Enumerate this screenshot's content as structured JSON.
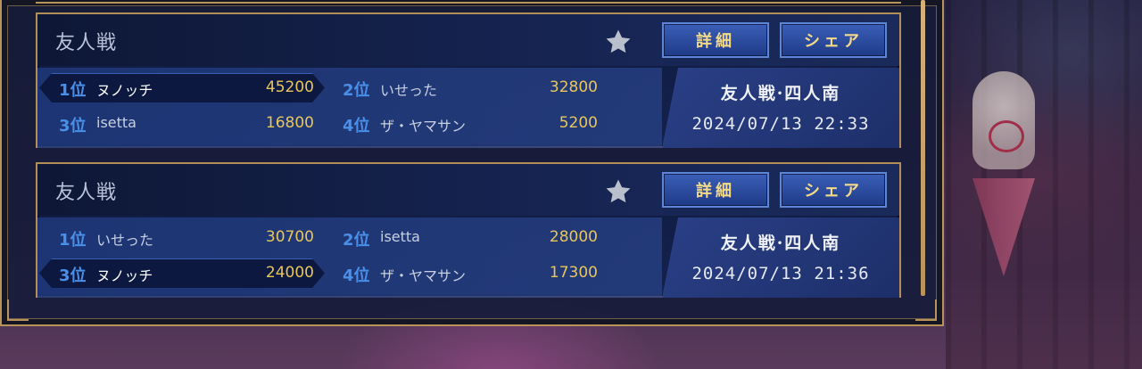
{
  "records": [
    {
      "title": "友人戦",
      "detail_label": "詳細",
      "share_label": "シェア",
      "mode": "友人戦·四人南",
      "datetime": "2024/07/13 22:33",
      "players": [
        {
          "rank": "1位",
          "name": "ヌノッチ",
          "score": "45200",
          "highlight": true
        },
        {
          "rank": "2位",
          "name": "いせった",
          "score": "32800",
          "highlight": false
        },
        {
          "rank": "3位",
          "name": "isetta",
          "score": "16800",
          "highlight": false
        },
        {
          "rank": "4位",
          "name": "ザ・ヤマサン",
          "score": "5200",
          "highlight": false
        }
      ]
    },
    {
      "title": "友人戦",
      "detail_label": "詳細",
      "share_label": "シェア",
      "mode": "友人戦·四人南",
      "datetime": "2024/07/13 21:36",
      "players": [
        {
          "rank": "1位",
          "name": "いせった",
          "score": "30700",
          "highlight": false
        },
        {
          "rank": "2位",
          "name": "isetta",
          "score": "28000",
          "highlight": false
        },
        {
          "rank": "3位",
          "name": "ヌノッチ",
          "score": "24000",
          "highlight": true
        },
        {
          "rank": "4位",
          "name": "ザ・ヤマサン",
          "score": "17300",
          "highlight": false
        }
      ]
    }
  ],
  "icons": {
    "favorite": "star-icon"
  },
  "colors": {
    "gold_border": "#b9935a",
    "rank_blue": "#4a8fe8",
    "score_yellow": "#e8c75a",
    "button_text": "#f3d98a"
  }
}
